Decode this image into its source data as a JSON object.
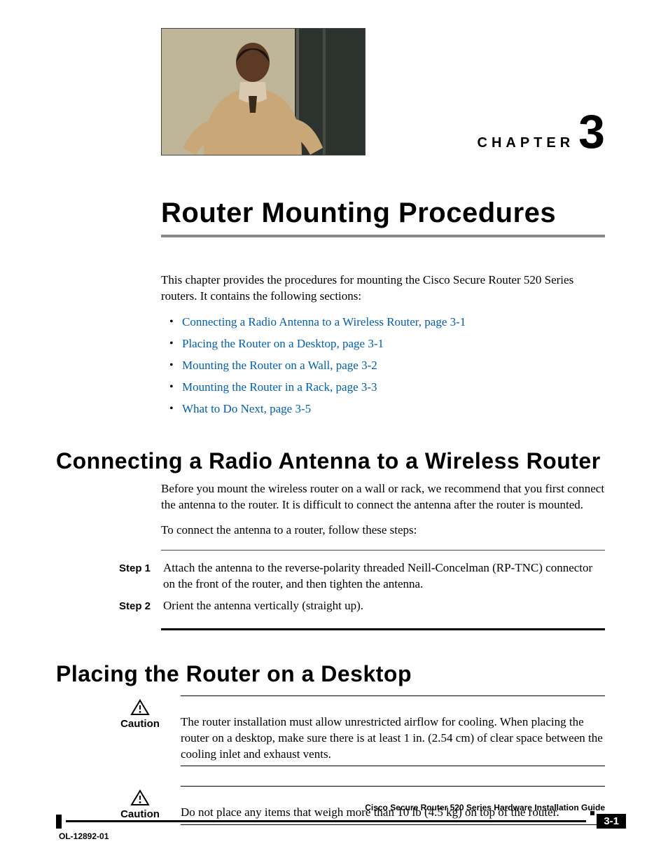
{
  "chapter": {
    "label": "CHAPTER",
    "number": "3"
  },
  "title": "Router Mounting Procedures",
  "intro": "This chapter provides the procedures for mounting the Cisco Secure Router 520 Series routers. It contains the following sections:",
  "toc": [
    "Connecting a Radio Antenna to a Wireless Router, page 3-1",
    "Placing the Router on a Desktop, page 3-1",
    "Mounting the Router on a Wall, page 3-2",
    "Mounting the Router in a Rack, page 3-3",
    "What to Do Next, page 3-5"
  ],
  "section1": {
    "heading": "Connecting a Radio Antenna to a Wireless Router",
    "p1": "Before you mount the wireless router on a wall or rack, we recommend that you first connect the antenna to the router. It is difficult to connect the antenna after the router is mounted.",
    "p2": "To connect the antenna to a router, follow these steps:",
    "steps": [
      {
        "label": "Step 1",
        "text": "Attach the antenna to the reverse-polarity threaded Neill-Concelman (RP-TNC) connector on the front of the router, and then tighten the antenna."
      },
      {
        "label": "Step 2",
        "text": "Orient the antenna vertically (straight up)."
      }
    ]
  },
  "section2": {
    "heading": "Placing the Router on a Desktop",
    "cautions": [
      {
        "label": "Caution",
        "text": "The router installation must allow unrestricted airflow for cooling. When placing the router on a desktop, make sure there is at least 1 in. (2.54 cm) of clear space between the cooling inlet and exhaust vents."
      },
      {
        "label": "Caution",
        "text": "Do not place any items that weigh more than 10 lb (4.5 kg) on top of the router."
      }
    ]
  },
  "footer": {
    "book": "Cisco Secure Router 520 Series Hardware Installation Guide",
    "doc_id": "OL-12892-01",
    "page": "3-1"
  }
}
